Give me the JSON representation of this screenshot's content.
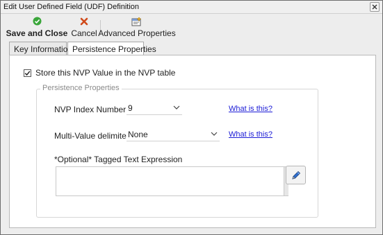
{
  "window": {
    "title": "Edit User Defined Field (UDF) Definition"
  },
  "toolbar": {
    "save_label": "Save and Close",
    "cancel_label": "Cancel",
    "advanced_label": "Advanced Properties",
    "save_icon": "green-check-icon",
    "cancel_icon": "red-x-icon",
    "advanced_icon": "properties-window-icon"
  },
  "tabs": [
    {
      "label": "Key Information",
      "active": false
    },
    {
      "label": "Persistence Properties",
      "active": true
    }
  ],
  "panel": {
    "store_checkbox_label": "Store this NVP Value in the NVP table",
    "store_checked": true,
    "group_title": "Persistence Properties",
    "nvp_index_label": "NVP Index Number:",
    "nvp_index_value": "9",
    "nvp_index_help": "What is this?",
    "delimiter_label": "Multi-Value delimiter:",
    "delimiter_value": "None",
    "delimiter_help": "What is this?",
    "expression_label": "*Optional* Tagged Text Expression",
    "expression_value": ""
  },
  "colors": {
    "link": "#1a1ad6",
    "accent_green": "#3aa63a",
    "accent_red": "#d04a1a",
    "edit_icon_blue": "#2f6fd0"
  }
}
